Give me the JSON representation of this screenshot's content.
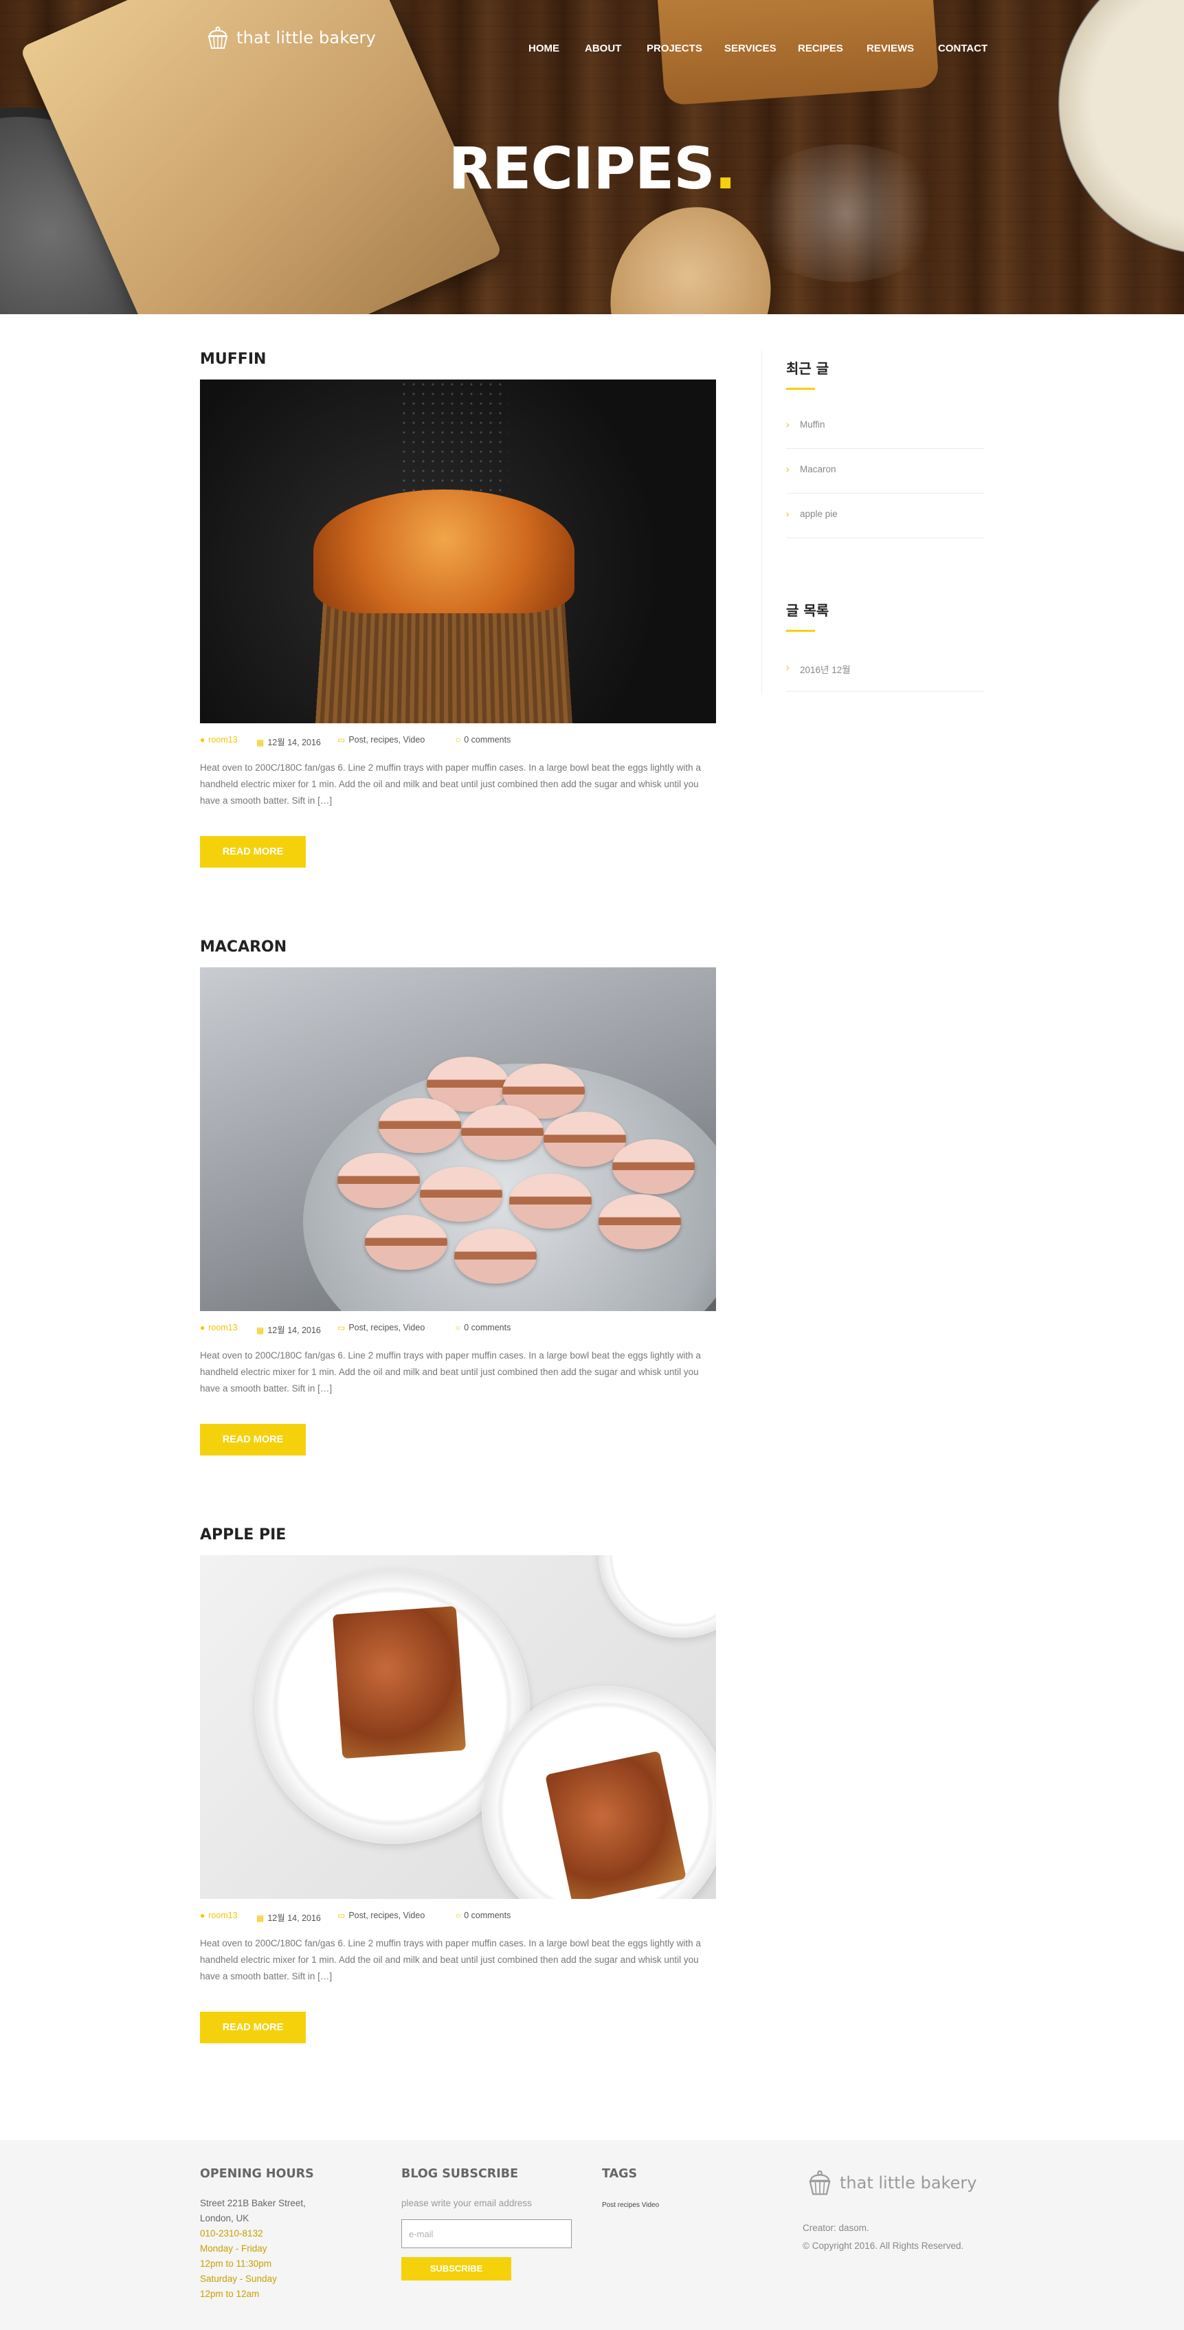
{
  "site": {
    "logo_text": "that little bakery"
  },
  "nav": {
    "items": [
      "HOME",
      "ABOUT",
      "PROJECTS",
      "SERVICES",
      "RECIPES",
      "REVIEWS",
      "CONTACT"
    ]
  },
  "hero": {
    "title": "RECIPES",
    "title_dot": "."
  },
  "posts": [
    {
      "title": "MUFFIN",
      "author": "room13",
      "date": "12월 14, 2016",
      "categories": "Post, recipes, Video",
      "comments": "0 comments",
      "excerpt": "Heat oven to 200C/180C fan/gas 6. Line 2 muffin trays with paper muffin cases. In a large bowl beat the eggs lightly with a handheld electric mixer for 1 min. Add the oil and milk and beat until just combined then add the sugar and whisk until you have a smooth batter. Sift in […]",
      "button": "READ MORE"
    },
    {
      "title": "MACARON",
      "author": "room13",
      "date": "12월 14, 2016",
      "categories": "Post, recipes, Video",
      "comments": "0 comments",
      "excerpt": "Heat oven to 200C/180C fan/gas 6. Line 2 muffin trays with paper muffin cases. In a large bowl beat the eggs lightly with a handheld electric mixer for 1 min. Add the oil and milk and beat until just combined then add the sugar and whisk until you have a smooth batter. Sift in […]",
      "button": "READ MORE"
    },
    {
      "title": "APPLE PIE",
      "author": "room13",
      "date": "12월 14, 2016",
      "categories": "Post, recipes, Video",
      "comments": "0 comments",
      "excerpt": "Heat oven to 200C/180C fan/gas 6. Line 2 muffin trays with paper muffin cases. In a large bowl beat the eggs lightly with a handheld electric mixer for 1 min. Add the oil and milk and beat until just combined then add the sugar and whisk until you have a smooth batter. Sift in […]",
      "button": "READ MORE"
    }
  ],
  "sidebar": {
    "recent_title": "최근 글",
    "recent_items": [
      "Muffin",
      "Macaron",
      "apple pie"
    ],
    "archive_title": "글 목록",
    "archive_items": [
      "2016년 12월"
    ]
  },
  "footer": {
    "hours_title": "OPENING HOURS",
    "hours_lines": [
      "Street 221B Baker Street,",
      "London, UK",
      "010-2310-8132",
      "Monday - Friday",
      "12pm to 11:30pm",
      "Saturday - Sunday",
      "12pm to 12am"
    ],
    "subscribe_title": "BLOG SUBSCRIBE",
    "subscribe_text": "please write your email address",
    "email_placeholder": "e-mail",
    "subscribe_button": "SUBSCRIBE",
    "tags_title": "TAGS",
    "tags": "Post recipes Video",
    "logo_text": "that little bakery",
    "creator": "Creator: dasom.",
    "copyright": "© Copyright 2016. All Rights Reserved."
  },
  "colors": {
    "accent": "#f5d10c",
    "footer_bg": "#f5f5f5"
  }
}
